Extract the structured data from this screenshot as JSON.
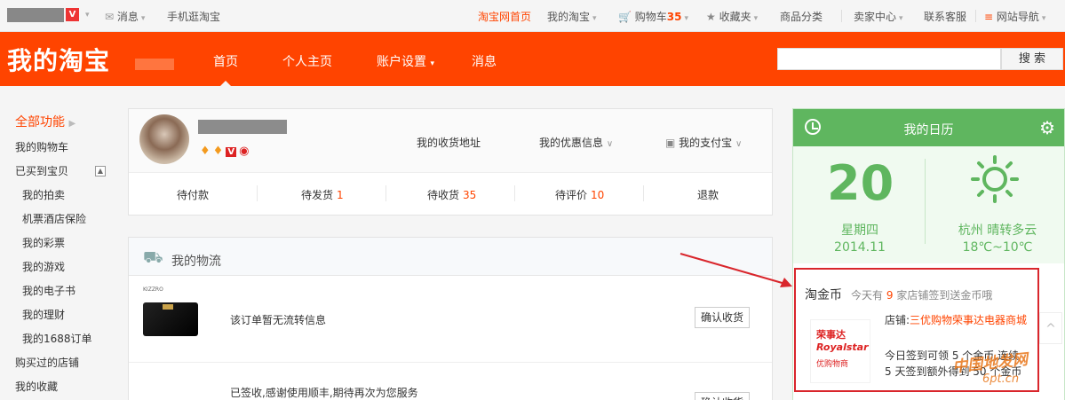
{
  "topbar": {
    "message": "消息",
    "mobile": "手机逛淘宝",
    "home": "淘宝网首页",
    "my_taobao": "我的淘宝",
    "cart_label": "购物车",
    "cart_count": "35",
    "favorites": "收藏夹",
    "categories": "商品分类",
    "seller_center": "卖家中心",
    "customer_service": "联系客服",
    "site_nav": "网站导航"
  },
  "header": {
    "logo": "我的淘宝",
    "nav": [
      "首页",
      "个人主页",
      "账户设置",
      "消息"
    ],
    "search_button": "搜 索",
    "search_value": ""
  },
  "sidebar": {
    "all_functions": "全部功能",
    "items": [
      {
        "label": "我的购物车",
        "sub": false
      },
      {
        "label": "已买到宝贝",
        "sub": false
      },
      {
        "label": "我的拍卖",
        "sub": true
      },
      {
        "label": "机票酒店保险",
        "sub": true
      },
      {
        "label": "我的彩票",
        "sub": true
      },
      {
        "label": "我的游戏",
        "sub": true
      },
      {
        "label": "我的电子书",
        "sub": true
      },
      {
        "label": "我的理财",
        "sub": true
      },
      {
        "label": "我的1688订单",
        "sub": true
      },
      {
        "label": "购买过的店铺",
        "sub": false
      },
      {
        "label": "我的收藏",
        "sub": false
      }
    ]
  },
  "profile": {
    "links": {
      "address": "我的收货地址",
      "coupons": "我的优惠信息",
      "alipay": "我的支付宝"
    },
    "orders": [
      {
        "label": "待付款",
        "count": ""
      },
      {
        "label": "待发货",
        "count": "1"
      },
      {
        "label": "待收货",
        "count": "35"
      },
      {
        "label": "待评价",
        "count": "10"
      },
      {
        "label": "退款",
        "count": ""
      }
    ]
  },
  "logistics": {
    "title": "我的物流",
    "rows": [
      {
        "brand": "KIZZRO",
        "message": "该订单暂无流转信息",
        "button": "确认收货"
      },
      {
        "brand": "",
        "message": "已签收,感谢使用顺丰,期待再次为您服务",
        "button": "确认收货"
      }
    ]
  },
  "calendar": {
    "title": "我的日历",
    "day": "20",
    "weekday": "星期四",
    "year_month": "2014.11",
    "weather": "杭州 晴转多云",
    "temperature": "18℃~10℃"
  },
  "gold_coin": {
    "title": "淘金币",
    "subtitle_pre": "今天有",
    "subtitle_count": "9",
    "subtitle_post": "家店铺签到送金币哦",
    "shop_label": "店铺:",
    "shop_name": "三优购物荣事达电器商城",
    "line1": "今日签到可领 5 个金币,连续",
    "line2": "5 天签到额外得到 50 个金币",
    "logo_text_cn": "荣事达",
    "logo_text_en": "Royalstar",
    "logo_text_sub": "优购物商"
  },
  "watermark": {
    "text": "中国地发网",
    "url": "6pt.cn"
  },
  "colors": {
    "brand_orange": "#ff4400",
    "calendar_green": "#5fb65f",
    "highlight_red": "#d9262c"
  }
}
